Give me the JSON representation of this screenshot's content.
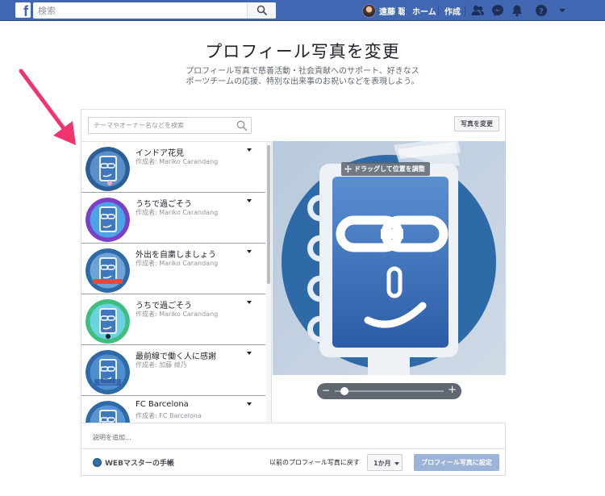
{
  "topbar": {
    "logo": "f",
    "search_placeholder": "検索",
    "user_name": "遠藤 聡",
    "links": [
      "ホーム",
      "作成"
    ],
    "icons": [
      "friends-icon",
      "messenger-icon",
      "notifications-icon",
      "help-icon",
      "account-menu-icon"
    ]
  },
  "header": {
    "title": "プロフィール写真を変更",
    "description": "プロフィール写真で慈善活動・社会貢献へのサポート、好きなスポーツチームの応援、特別な出来事のお祝いなどを表現しよう。"
  },
  "dialog": {
    "search_placeholder": "テーマやオーナー名などを検索",
    "change_photo_label": "写真を変更",
    "frames": [
      {
        "name": "インドア花見",
        "author": "作成者: Mariko Carandang",
        "theme": "hanami"
      },
      {
        "name": "うちで過ごそう",
        "author": "作成者: Mariko Carandang",
        "theme": "purple"
      },
      {
        "name": "外出を自粛しましょう",
        "author": "作成者: Mariko Carandang",
        "theme": "banner"
      },
      {
        "name": "うちで過ごそう",
        "author": "作成者: Mariko Carandang",
        "theme": "green"
      },
      {
        "name": "最前線で働く人に感謝",
        "author": "作成者: 加藤 綾乃",
        "theme": "thanks"
      },
      {
        "name": "FC Barcelona",
        "author": "作成者: FC Barcelona",
        "theme": "barca"
      }
    ],
    "drag_hint": "ドラッグして位置を調整",
    "zoom": {
      "minus": "−",
      "plus": "+",
      "level": 0.04
    },
    "add_description_placeholder": "説明を追加...",
    "page_selector": "WEBマスターの手帳",
    "revert_label": "以前のプロフィール写真に戻す",
    "revert_period": "1か月",
    "set_profile_label": "プロフィール写真に設定"
  },
  "colors": {
    "header_blue": "#4267b2",
    "annotation_arrow": "#f0346e",
    "primary_disabled": "#9cb4d8"
  }
}
